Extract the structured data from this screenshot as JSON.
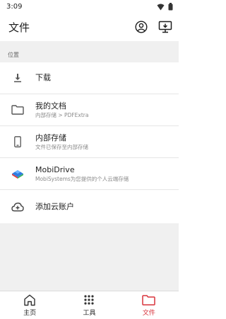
{
  "status_bar": {
    "time": "3:09"
  },
  "header": {
    "title": "文件"
  },
  "section": {
    "label": "位置"
  },
  "locations": [
    {
      "title": "下载",
      "subtitle": "",
      "icon": "download-icon"
    },
    {
      "title": "我的文档",
      "subtitle": "内部存储 > PDFExtra",
      "icon": "folder-icon"
    },
    {
      "title": "内部存储",
      "subtitle": "文件已保存至内部存储",
      "icon": "phone-storage-icon"
    },
    {
      "title": "MobiDrive",
      "subtitle": "MobiSystems为您提供的个人云端存储",
      "icon": "mobidrive-icon"
    },
    {
      "title": "添加云账户",
      "subtitle": "",
      "icon": "cloud-add-icon"
    }
  ],
  "bottom_nav": {
    "items": [
      {
        "label": "主页",
        "icon": "home-icon",
        "active": false
      },
      {
        "label": "工具",
        "icon": "grid-icon",
        "active": false
      },
      {
        "label": "文件",
        "icon": "folder-icon",
        "active": true
      }
    ]
  },
  "colors": {
    "accent": "#d8343c",
    "background": "#f0f0f0",
    "surface": "#ffffff"
  }
}
